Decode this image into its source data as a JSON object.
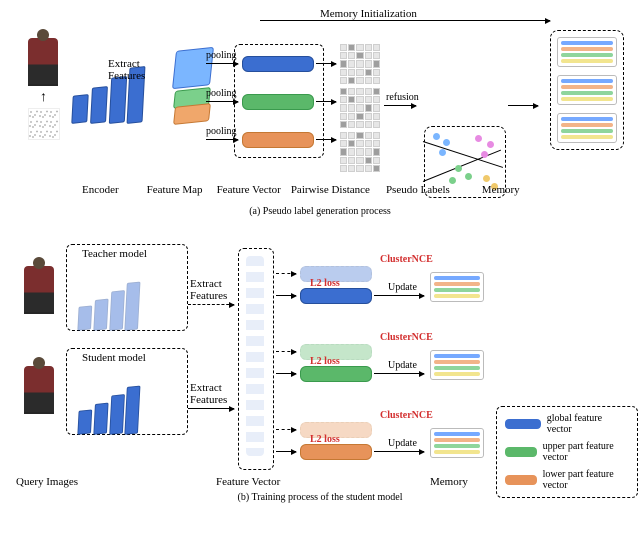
{
  "panel_a": {
    "caption": "(a) Pseudo label generation process",
    "input_arrow": "↑",
    "extract_features": "Extract\nFeatures",
    "pooling": "pooling",
    "refusion": "refusion",
    "memory_init": "Memory Initialization",
    "axis": {
      "encoder": "Encoder",
      "feature_map": "Feature Map",
      "feature_vector": "Feature Vector",
      "pairwise_distance": "Pairwise Distance",
      "pseudo_labels": "Pseudo Labels",
      "memory": "Memory"
    }
  },
  "panel_b": {
    "caption": "(b) Training process of the student model",
    "teacher_model": "Teacher model",
    "student_model": "Student model",
    "query_images": "Query Images",
    "extract_features": "Extract\nFeatures",
    "feature_vector": "Feature Vector",
    "memory": "Memory",
    "clusterNCE": "ClusterNCE",
    "l2loss": "L2 loss",
    "update": "Update",
    "legend": {
      "global": "global feature vector",
      "upper": "upper part feature vector",
      "lower": "lower part feature vector"
    }
  }
}
